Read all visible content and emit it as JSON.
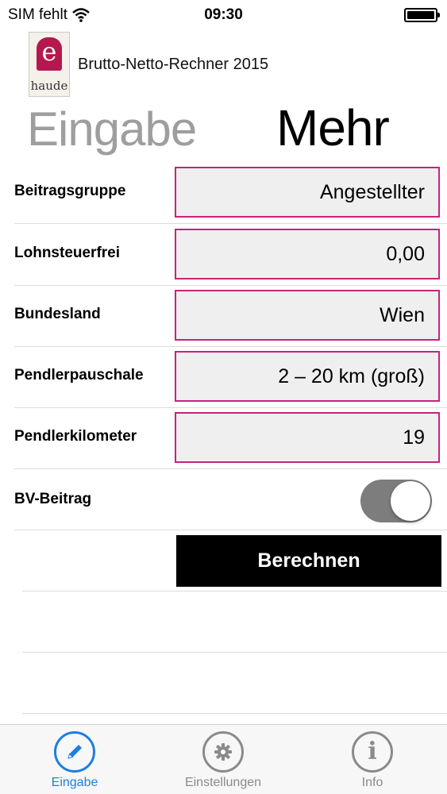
{
  "status_bar": {
    "carrier": "SIM fehlt",
    "time": "09:30"
  },
  "header": {
    "logo_letter": "e",
    "logo_text": "haude",
    "app_title": "Brutto-Netto-Rechner 2015"
  },
  "segments": {
    "left": "Eingabe",
    "right": "Mehr",
    "selected": "Mehr"
  },
  "form": {
    "rows": [
      {
        "label": "Beitragsgruppe",
        "value": "Angestellter"
      },
      {
        "label": "Lohnsteuerfrei",
        "value": "0,00"
      },
      {
        "label": "Bundesland",
        "value": "Wien"
      },
      {
        "label": "Pendlerpauschale",
        "value": "2 – 20 km (groß)"
      },
      {
        "label": "Pendlerkilometer",
        "value": "19"
      }
    ],
    "bv_label": "BV-Beitrag",
    "bv_enabled": true,
    "calculate_label": "Berechnen"
  },
  "tab_bar": {
    "items": [
      {
        "label": "Eingabe",
        "icon": "pencil-icon",
        "active": true
      },
      {
        "label": "Einstellungen",
        "icon": "gear-icon",
        "active": false
      },
      {
        "label": "Info",
        "icon": "info-icon",
        "active": false
      }
    ],
    "active_color": "#1b7fe0",
    "inactive_color": "#8a8a8a"
  },
  "colors": {
    "field_border": "#c8237a",
    "field_bg": "#efefef",
    "logo_accent": "#b5174f"
  }
}
